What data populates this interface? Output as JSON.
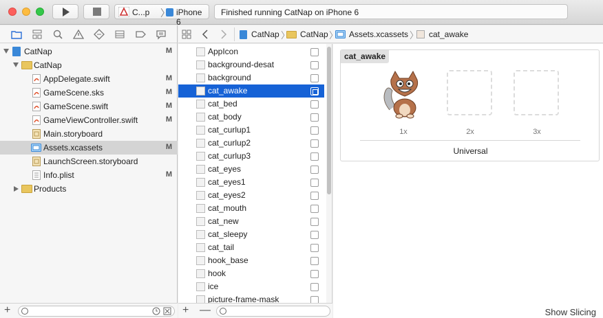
{
  "toolbar": {
    "scheme_name": "C...p",
    "scheme_separator": "〉",
    "device_name": "iPhone 6",
    "activity_text": "Finished running CatNap on iPhone 6"
  },
  "navigator": {
    "tabs": [
      "folder-icon",
      "hierarchy-icon",
      "search-icon",
      "warning-icon",
      "test-icon",
      "debug-icon",
      "breakpoint-icon",
      "report-icon"
    ],
    "rows": [
      {
        "label": "CatNap",
        "badge": "M",
        "kind": "project"
      },
      {
        "label": "CatNap",
        "badge": "",
        "kind": "folder"
      },
      {
        "label": "AppDelegate.swift",
        "badge": "M",
        "kind": "swift"
      },
      {
        "label": "GameScene.sks",
        "badge": "M",
        "kind": "swift"
      },
      {
        "label": "GameScene.swift",
        "badge": "M",
        "kind": "swift"
      },
      {
        "label": "GameViewController.swift",
        "badge": "M",
        "kind": "swift"
      },
      {
        "label": "Main.storyboard",
        "badge": "",
        "kind": "storyboard"
      },
      {
        "label": "Assets.xcassets",
        "badge": "M",
        "kind": "assets"
      },
      {
        "label": "LaunchScreen.storyboard",
        "badge": "",
        "kind": "storyboard"
      },
      {
        "label": "Info.plist",
        "badge": "M",
        "kind": "plist"
      },
      {
        "label": "Products",
        "badge": "",
        "kind": "folder"
      }
    ]
  },
  "jumpbar": {
    "items": [
      "CatNap",
      "CatNap",
      "Assets.xcassets",
      "cat_awake"
    ]
  },
  "assets": [
    "AppIcon",
    "background-desat",
    "background",
    "cat_awake",
    "cat_bed",
    "cat_body",
    "cat_curlup1",
    "cat_curlup2",
    "cat_curlup3",
    "cat_eyes",
    "cat_eyes1",
    "cat_eyes2",
    "cat_mouth",
    "cat_new",
    "cat_sleepy",
    "cat_tail",
    "hook_base",
    "hook",
    "ice",
    "picture-frame-mask"
  ],
  "detail": {
    "set_name": "cat_awake",
    "scales": [
      "1x",
      "2x",
      "3x"
    ],
    "idiom": "Universal",
    "show_slicing": "Show Slicing"
  },
  "colors": {
    "selection": "#1662d6",
    "nav_selection": "#d4d4d4"
  }
}
